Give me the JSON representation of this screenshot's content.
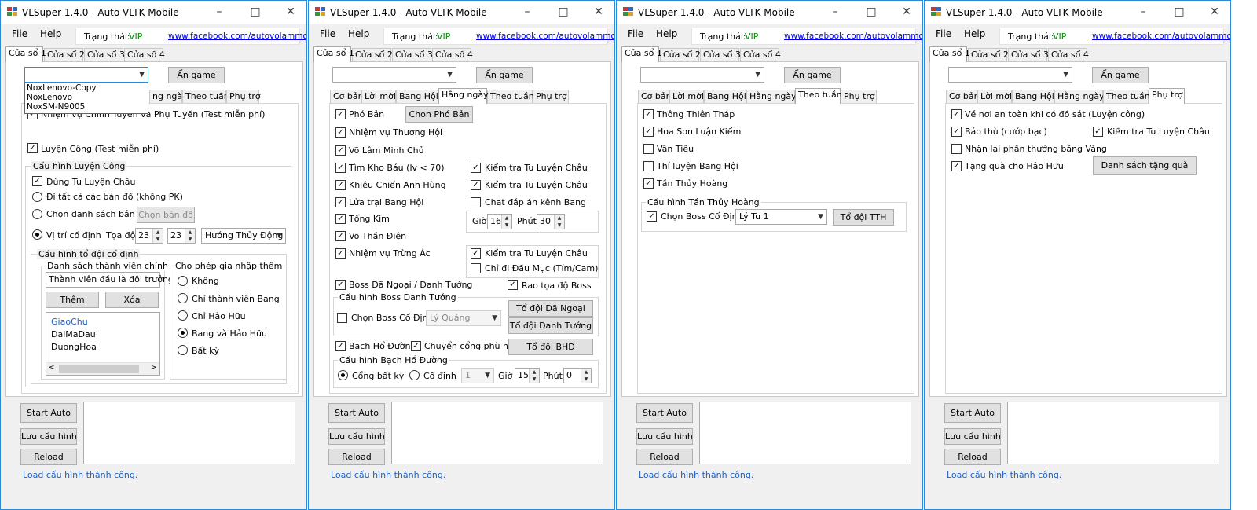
{
  "window": {
    "title": "VLSuper 1.4.0 - Auto VLTK Mobile",
    "minimize_glyph": "–",
    "maximize_glyph": "□",
    "close_glyph": "✕",
    "icon": "app-icon"
  },
  "menu": {
    "file": "File",
    "help": "Help"
  },
  "status": {
    "label": "Trạng thái:",
    "value": "VIP",
    "link": "www.facebook.com/autovolammobi"
  },
  "tabs": [
    "Cửa sổ 1",
    "Cửa sổ 2",
    "Cửa sổ 3",
    "Cửa sổ 4"
  ],
  "hide_game_btn": "Ẩn game",
  "subtabs": [
    "Cơ bản",
    "Lời mời",
    "Bang Hội",
    "Hằng ngày",
    "Theo tuần",
    "Phụ trợ"
  ],
  "device_dropdown": [
    "NoxLenovo-Copy",
    "NoxLenovo",
    "NoxSM-N9005"
  ],
  "win1": {
    "partial_tab": "ng ngày",
    "quest": "Nhiệm vụ Chính Tuyến và Phụ Tuyến (Test miễn phí)",
    "train": "Luyện Công (Test miễn phí)",
    "train_cfg": "Cấu hình Luyện Công",
    "use_tlc": "Dùng Tu Luyện Châu",
    "all_maps": "Đi tất cả các bản đồ (không PK)",
    "choose_maps": "Chọn danh sách bản đồ",
    "choose_maps_btn": "Chọn bản đồ",
    "fixed_pos": "Vị trí cố định",
    "coord_label": "Tọa độ",
    "x": "23",
    "y": "23",
    "direction": "Hướng Thủy Động",
    "team_cfg": "Cấu hình tổ đội cố định",
    "members_title": "Danh sách thành viên chính",
    "members_input": "Thành viên đầu là đội trưởng",
    "add": "Thêm",
    "remove": "Xóa",
    "members": [
      "GiaoChu",
      "DaiMaDau",
      "DuongHoa"
    ],
    "allow_title": "Cho phép gia nhập thêm",
    "allow": [
      "Không",
      "Chỉ thành viên Bang",
      "Chỉ Hảo Hữu",
      "Bang và Hảo Hữu",
      "Bất kỳ"
    ]
  },
  "daily": {
    "pho_ban": "Phó Bản",
    "pho_ban_btn": "Chọn Phó Bản",
    "thuong_hoi": "Nhiệm vụ Thương Hội",
    "vo_lam": "Võ Lâm Minh Chủ",
    "tim_kho": "Tìm Kho Báu (lv < 70)",
    "check_tlc": "Kiểm tra Tu Luyện Châu",
    "khieu_chien": "Khiêu Chiến Anh Hùng",
    "lua_trai": "Lửa trại Bang Hội",
    "chat_dap_an": "Chat đáp án kênh Bang",
    "tong_kim": "Tống Kim",
    "gio": "Giờ",
    "phut": "Phút",
    "gio_v": "16",
    "phut_v": "30",
    "vo_than": "Võ Thần Điện",
    "trung_ac": "Nhiệm vụ Trừng Ác",
    "only_dau_muc": "Chỉ đi Đầu Mục (Tím/Cam)",
    "boss_da_ngoai": "Boss Dã Ngoại / Danh Tướng",
    "rao_toa_do": "Rao tọa độ Boss",
    "boss_cfg": "Cấu hình Boss Danh Tướng",
    "to_doi_da_ngoai": "Tổ đội Dã Ngoại",
    "chon_boss": "Chọn Boss Cố Định",
    "boss_sel": "Lý Quảng",
    "to_doi_danh_tuong": "Tổ đội Danh Tướng",
    "bach_ho": "Bạch Hổ Đường",
    "chuyen_cong": "Chuyển cổng phù hợp",
    "to_doi_bhd": "Tổ đội BHD",
    "bhd_cfg": "Cấu hình Bạch Hổ Đường",
    "cong_bat_ky": "Cổng bất kỳ",
    "co_dinh": "Cố định",
    "cong_sel": "1",
    "gio2": "15",
    "phut2": "0"
  },
  "weekly": {
    "items": [
      "Thông Thiên Tháp",
      "Hoa Sơn Luận Kiếm",
      "Vân Tiêu",
      "Thí luyện Bang Hội",
      "Tần Thủy Hoàng"
    ],
    "cfg": "Cấu hình Tần Thủy Hoàng",
    "chon_boss": "Chọn Boss Cố Định",
    "boss_sel": "Lý Tu 1",
    "to_doi": "Tổ đội TTH"
  },
  "support": {
    "safe": "Về nơi an toàn khi có đồ sát (Luyện công)",
    "bao_thu": "Báo thù (cướp bạc)",
    "check_tlc": "Kiểm tra Tu Luyện Châu",
    "nhan_lai": "Nhận lại phần thưởng bằng Vàng",
    "tang_qua": "Tặng quà cho Hảo Hữu",
    "gift_btn": "Danh sách tặng quà"
  },
  "bottom": {
    "start": "Start Auto",
    "save": "Lưu cấu hình",
    "reload": "Reload",
    "status": "Load cấu hình thành công."
  }
}
